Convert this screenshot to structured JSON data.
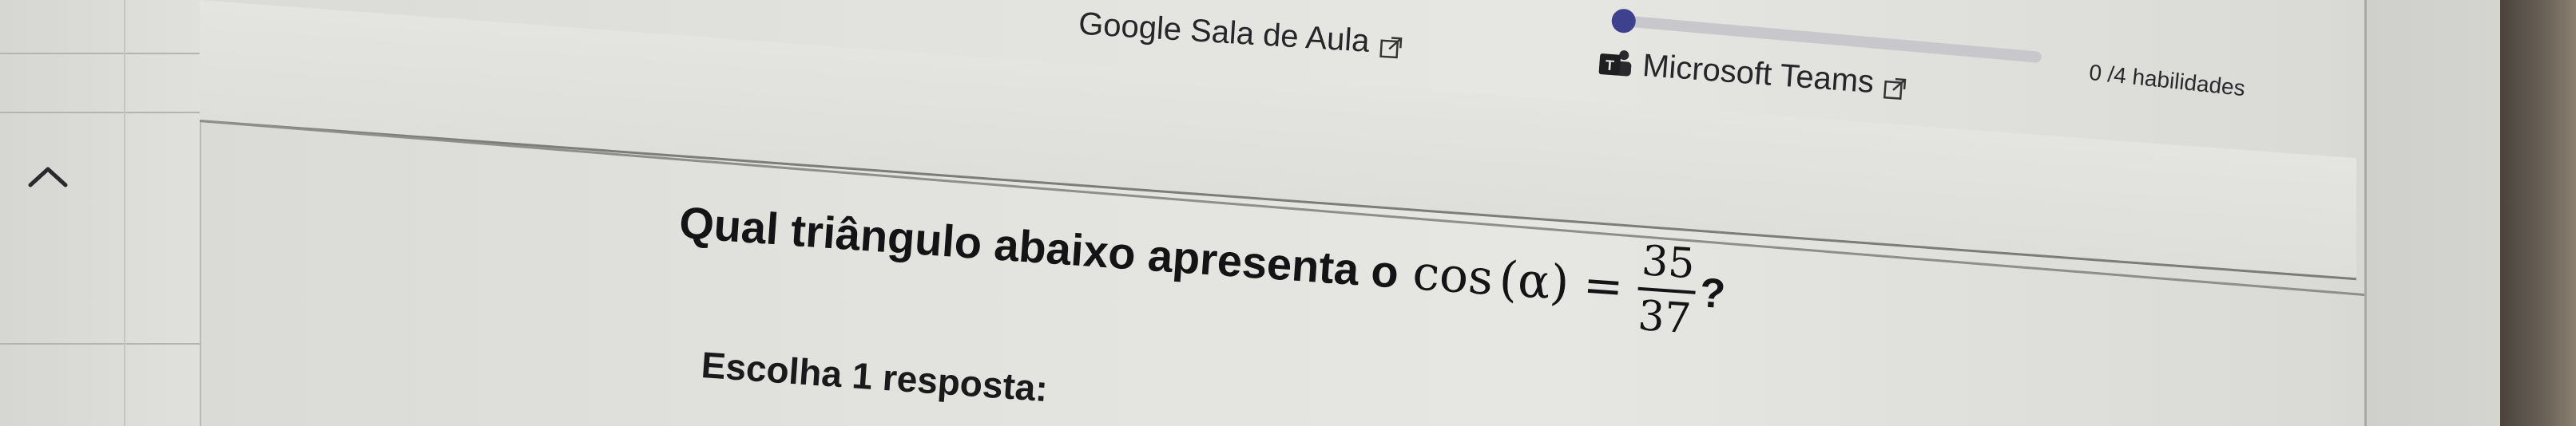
{
  "header": {
    "links": [
      {
        "label": "Google Sala de Aula",
        "icon": "external-link-icon"
      },
      {
        "label": "Microsoft Teams",
        "icon": "external-link-icon",
        "brand_icon": "teams-icon"
      }
    ],
    "progress": {
      "fraction": 0.0,
      "label": "0 /4 habilidades"
    }
  },
  "sidebar": {
    "collapse_icon": "chevron-up-icon"
  },
  "question": {
    "prompt": "Qual triângulo abaixo apresenta o",
    "math_fn": "cos",
    "math_arg": "(α)",
    "math_eq": "=",
    "numerator": "35",
    "denominator": "37",
    "end": "?",
    "answer_prompt": "Escolha 1 resposta:"
  },
  "colors": {
    "accent": "#4a4d9a",
    "text": "#141416",
    "bezel": "#4a443d"
  }
}
